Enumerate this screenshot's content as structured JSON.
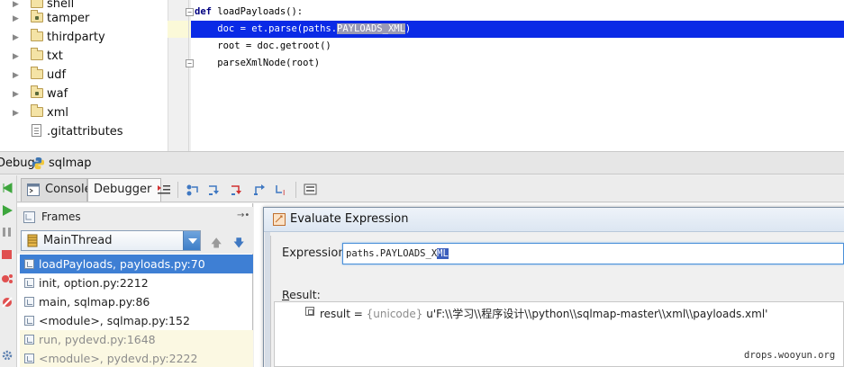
{
  "project_tree": {
    "items": [
      {
        "label": "shell",
        "kind": "folder",
        "expandable": true
      },
      {
        "label": "tamper",
        "kind": "package",
        "expandable": true
      },
      {
        "label": "thirdparty",
        "kind": "folder",
        "expandable": true
      },
      {
        "label": "txt",
        "kind": "folder",
        "expandable": true
      },
      {
        "label": "udf",
        "kind": "folder",
        "expandable": true
      },
      {
        "label": "waf",
        "kind": "package",
        "expandable": true
      },
      {
        "label": "xml",
        "kind": "folder",
        "expandable": true
      },
      {
        "label": ".gitattributes",
        "kind": "file",
        "expandable": false
      }
    ]
  },
  "editor": {
    "lines": [
      {
        "keyword": "def",
        "text": " loadPayloads():"
      },
      {
        "before": "    doc = et.parse(paths.",
        "selected": "PAYLOADS_XML",
        "after": ")"
      },
      {
        "text": "    root = doc.getroot()"
      },
      {
        "text": "    parseXmlNode(root)"
      }
    ],
    "highlight_color": "#0a2ae6"
  },
  "debug_window": {
    "title_prefix": "Debug",
    "config_name": "sqlmap",
    "tabs": [
      {
        "label": "Console",
        "active": false
      },
      {
        "label": "Debugger",
        "active": true
      }
    ]
  },
  "frames": {
    "header": "Frames",
    "thread": "MainThread",
    "items": [
      {
        "label": "loadPayloads, payloads.py:70",
        "state": "selected"
      },
      {
        "label": "init, option.py:2212",
        "state": "normal"
      },
      {
        "label": "main, sqlmap.py:86",
        "state": "normal"
      },
      {
        "label": "<module>, sqlmap.py:152",
        "state": "normal"
      },
      {
        "label": "run, pydevd.py:1648",
        "state": "library"
      },
      {
        "label": "<module>, pydevd.py:2222",
        "state": "library"
      }
    ]
  },
  "evaluate": {
    "title": "Evaluate Expression",
    "expression_label": "Expression:",
    "expression_parts": {
      "plain": "paths.PAYLOADS_X",
      "selected_light": "",
      "selected": "ML"
    },
    "result_label": "Result:",
    "result": {
      "name": "result",
      "equals": " = ",
      "type": "{unicode}",
      "value": " u'F:\\\\学习\\\\程序设计\\\\python\\\\sqlmap-master\\\\xml\\\\payloads.xml'"
    }
  },
  "watermark": "drops.wooyun.org",
  "colors": {
    "selection_blue": "#3e7fd4",
    "library_frame_bg": "#fbf8e2",
    "dialog_border": "#7d8fa3"
  }
}
